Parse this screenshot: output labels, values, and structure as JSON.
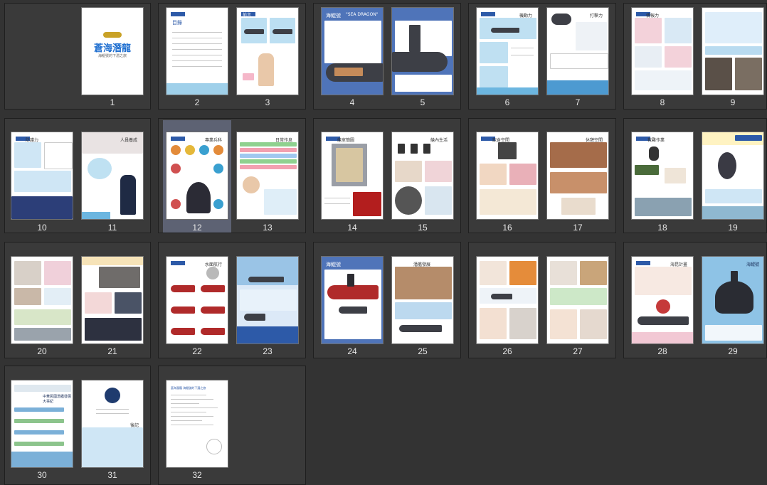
{
  "pages": [
    {
      "num": "1",
      "title": "蒼海潛龍",
      "subtitle": "海鯤號的下潛之旅"
    },
    {
      "num": "2",
      "title": "目錄"
    },
    {
      "num": "3",
      "title": "前言"
    },
    {
      "num": "4",
      "title": "海鯤號",
      "subtitle": "\"SEA DRAGON\""
    },
    {
      "num": "5"
    },
    {
      "num": "6",
      "title": "機動力"
    },
    {
      "num": "7",
      "title": "打擊力"
    },
    {
      "num": "8",
      "title": "情報力"
    },
    {
      "num": "9"
    },
    {
      "num": "10",
      "title": "防護力"
    },
    {
      "num": "11",
      "title": "人員養成"
    },
    {
      "num": "12",
      "title": "專業兵科"
    },
    {
      "num": "13",
      "title": "日常作息"
    },
    {
      "num": "14",
      "title": "艙室簡圖"
    },
    {
      "num": "15",
      "title": "艙內生活"
    },
    {
      "num": "16",
      "title": "飲食空間"
    },
    {
      "num": "17",
      "title": "休憩空間"
    },
    {
      "num": "18",
      "title": "救難作業"
    },
    {
      "num": "19"
    },
    {
      "num": "20"
    },
    {
      "num": "21"
    },
    {
      "num": "22",
      "title": "水面航行"
    },
    {
      "num": "23"
    },
    {
      "num": "24",
      "title": "海鯤號"
    },
    {
      "num": "25",
      "title": "潛艦發展"
    },
    {
      "num": "26"
    },
    {
      "num": "27"
    },
    {
      "num": "28",
      "title": "海昆計畫"
    },
    {
      "num": "29",
      "title": "海鯤號"
    },
    {
      "num": "30",
      "title": "中華民國潛艦發展大事紀"
    },
    {
      "num": "31",
      "title": "後記"
    },
    {
      "num": "32",
      "title": "蒼海潛龍 海鯤號的下潛之旅"
    }
  ],
  "colors": {
    "background": "#333333",
    "spread": "#3a3a3a",
    "selected": "#5d6273",
    "accent": "#2d5aa8"
  },
  "selected_page": "12"
}
